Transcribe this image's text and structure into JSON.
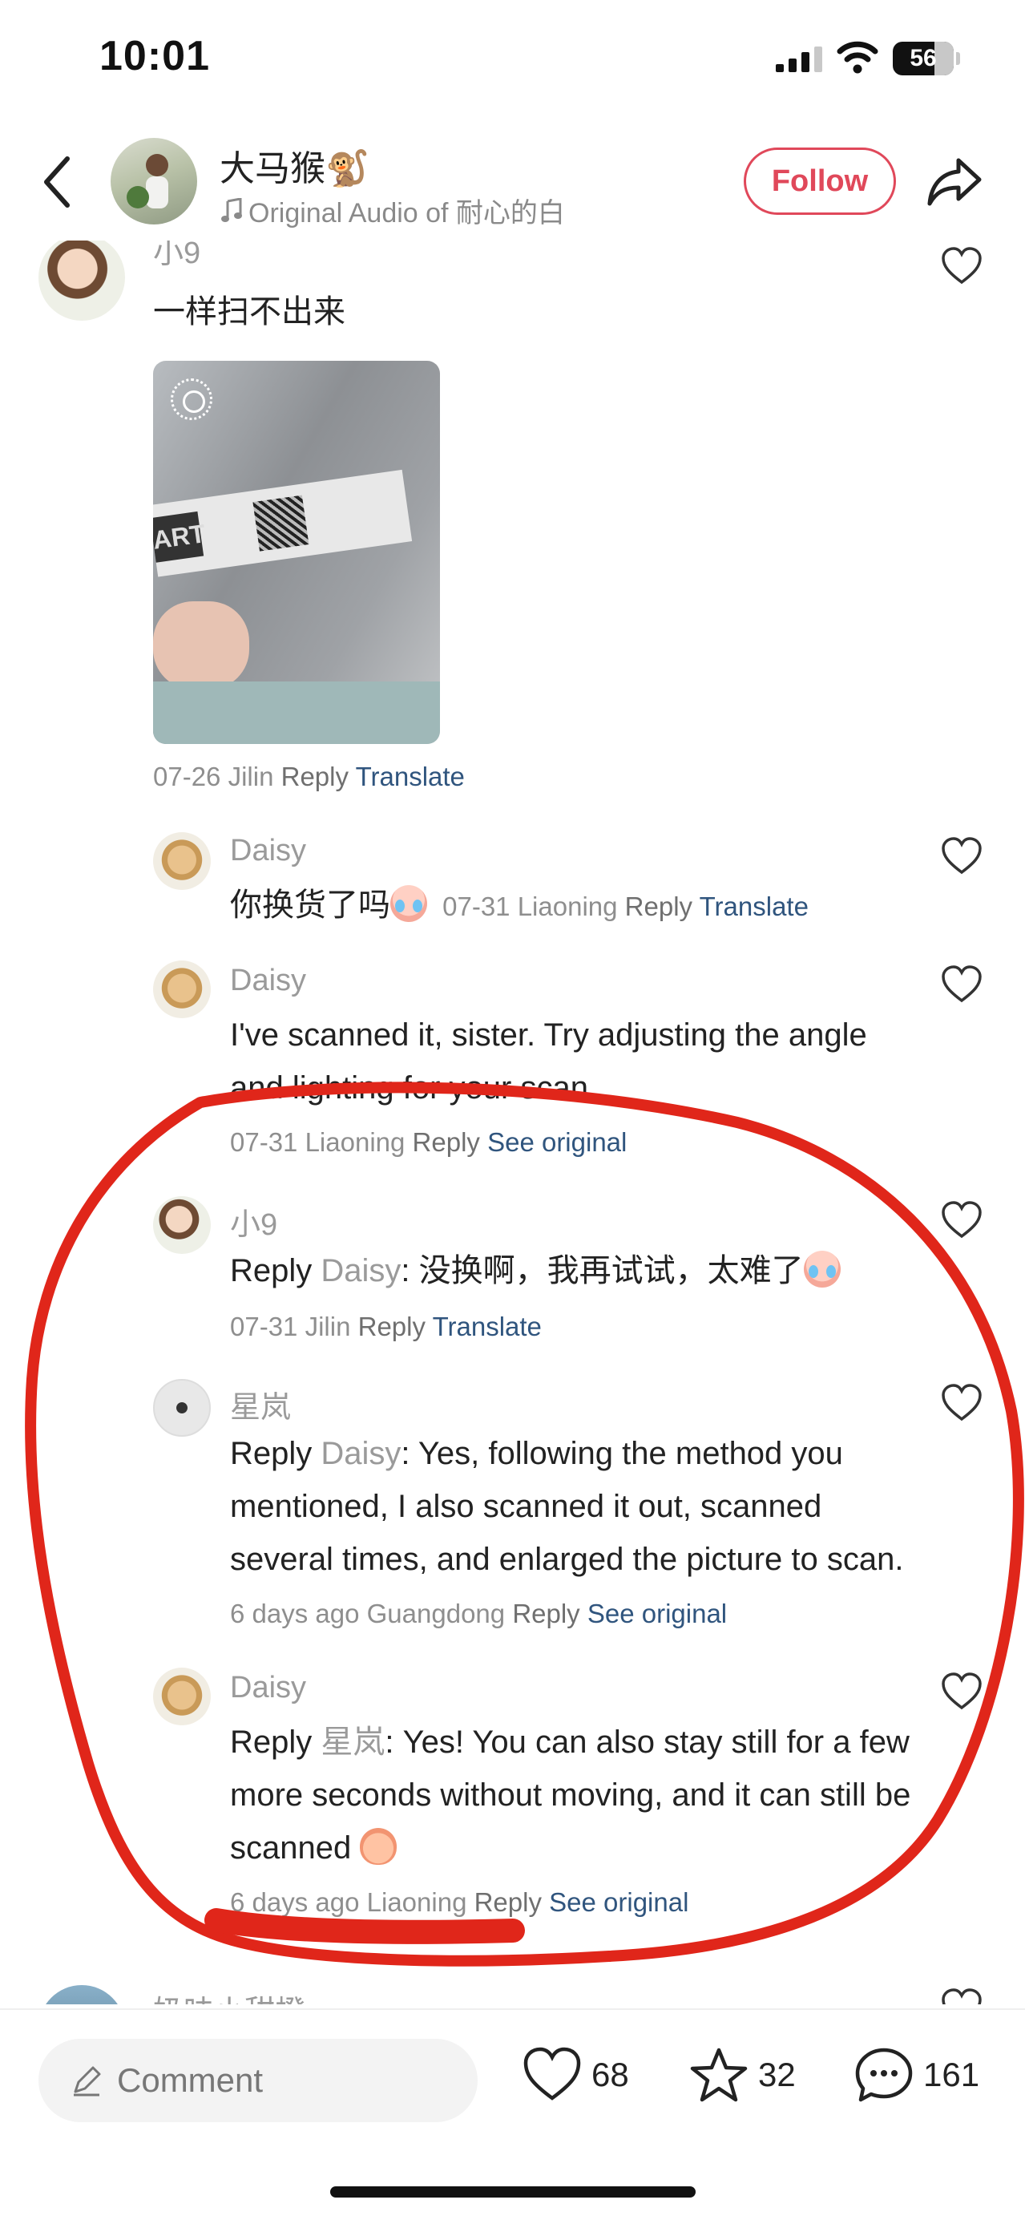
{
  "status_bar": {
    "time": "10:01",
    "battery": "56"
  },
  "header": {
    "author_name": "大马猴🐒",
    "audio_label": "Original Audio of 耐心的白",
    "follow_label": "Follow"
  },
  "comments": {
    "top": {
      "name": "小9",
      "text": "一样扫不出来",
      "date": "07-26",
      "location": "Jilin",
      "reply": "Reply",
      "link": "Translate"
    },
    "replies": [
      {
        "name": "Daisy",
        "text": "你换货了吗",
        "date": "07-31",
        "location": "Liaoning",
        "reply": "Reply",
        "link": "Translate"
      },
      {
        "name": "Daisy",
        "text": "I've scanned it, sister. Try adjusting the angle and lighting for your scan.",
        "date": "07-31",
        "location": "Liaoning",
        "reply": "Reply",
        "link": "See original"
      },
      {
        "name": "小9",
        "prefix": "Reply",
        "target": "Daisy",
        "text": ": 没换啊，我再试试，太难了",
        "date": "07-31",
        "location": "Jilin",
        "reply": "Reply",
        "link": "Translate"
      },
      {
        "name": "星岚",
        "prefix": "Reply",
        "target": "Daisy",
        "text": ": Yes, following the method you mentioned, I also scanned it out, scanned several times, and enlarged the picture to scan.",
        "date": "6 days ago",
        "location": "Guangdong",
        "reply": "Reply",
        "link": "See original"
      },
      {
        "name": "Daisy",
        "prefix": "Reply",
        "target": "星岚",
        "text": ": Yes! You can also stay still for a few more seconds without moving, and it can still be scanned",
        "date": "6 days ago",
        "location": "Liaoning",
        "reply": "Reply",
        "link": "See original"
      }
    ],
    "next": {
      "name": "奶味小甜橙"
    }
  },
  "bottom_bar": {
    "comment_placeholder": "Comment",
    "likes": "68",
    "favorites": "32",
    "comments": "161"
  },
  "colors": {
    "follow": "#e0485a",
    "link": "#30557e",
    "annotation": "#e0261a"
  }
}
